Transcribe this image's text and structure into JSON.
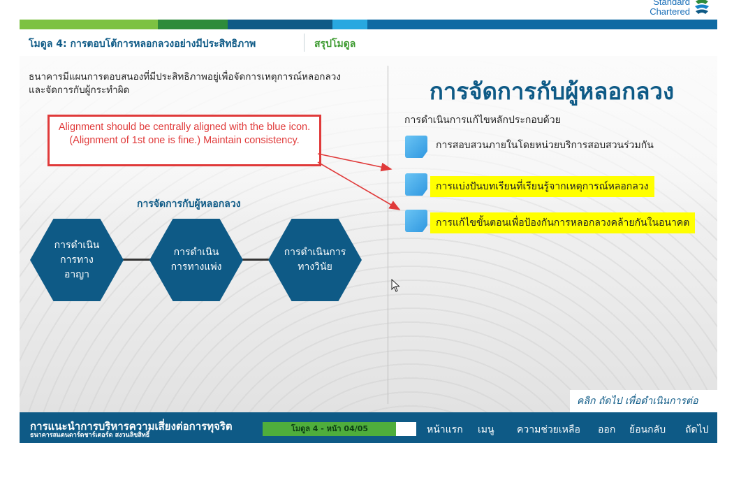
{
  "logo": {
    "line1": "Standard",
    "line2": "Chartered"
  },
  "stripe_colors": [
    "#7dc242",
    "#2e8b3a",
    "#0e5a86",
    "#1684c7",
    "#28a8e0",
    "#0e5a86"
  ],
  "header": {
    "module_title": "โมดูล 4: การตอบโต้การหลอกลวงอย่างมีประสิทธิภาพ",
    "summary_label": "สรุปโมดูล"
  },
  "left": {
    "intro_text": "ธนาคารมีแผนการตอบสนองที่มีประสิทธิภาพอยู่เพื่อจัดการเหตุการณ์หลอกลวงและจัดการกับผู้กระทำผิด",
    "annotation": "Alignment should be centrally aligned with the blue icon. (Alignment of 1st one is fine.) Maintain consistency.",
    "diagram_title": "การจัดการกับผู้หลอกลวง",
    "hexagons": [
      "การดำเนินการทางอาญา",
      "การดำเนินการทางแพ่ง",
      "การดำเนินการทางวินัย"
    ]
  },
  "right": {
    "heading": "การจัดการกับผู้หลอกลวง",
    "subheading": "การดำเนินการแก้ไขหลักประกอบด้วย",
    "bullets": [
      "การสอบสวนภายในโดยหน่วยบริการสอบสวนร่วมกัน",
      "การแบ่งปันบทเรียนที่เรียนรู้จากเหตุการณ์หลอกลวง",
      "การแก้ไขขั้นตอนเพื่อป้องกันการหลอกลวงคล้ายกันในอนาคต"
    ],
    "click_next": "คลิก ถัดไป เพื่อดำเนินการต่อ"
  },
  "footer": {
    "course_title": "การแนะนำการบริหารความเสี่ยงต่อการทุจริต",
    "bank_name": "ธนาคารสแตนดาร์ดชาร์เตอร์ด สงวนลิขสิทธิ์",
    "progress_label": "โมดูล 4 - หน้า 04/05",
    "progress_fraction": 0.87,
    "nav": [
      "หน้าแรก",
      "เมนู",
      "ความช่วยเหลือ",
      "ออก",
      "ย้อนกลับ",
      "ถัดไป"
    ]
  }
}
